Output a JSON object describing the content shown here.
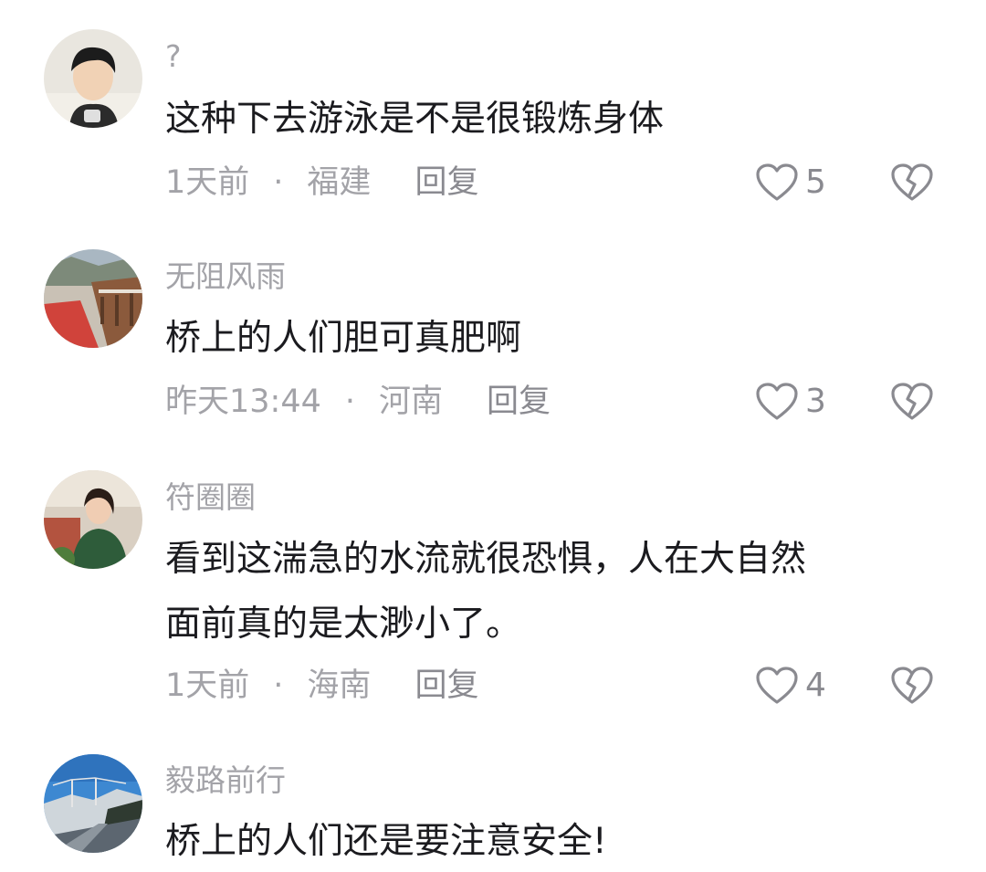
{
  "comments": [
    {
      "username": "?",
      "text_lines": [
        "这种下去游泳是不是很锻炼身体"
      ],
      "time": "1天前",
      "location": "福建",
      "reply_label": "回复",
      "likes": "5"
    },
    {
      "username": "无阻风雨",
      "text_lines": [
        "桥上的人们胆可真肥啊"
      ],
      "time": "昨天13:44",
      "location": "河南",
      "reply_label": "回复",
      "likes": "3"
    },
    {
      "username": "符圈圈",
      "text_lines": [
        "看到这湍急的水流就很恐惧，人在大自然",
        "面前真的是太渺小了。"
      ],
      "time": "1天前",
      "location": "海南",
      "reply_label": "回复",
      "likes": "4"
    },
    {
      "username": "毅路前行",
      "text_lines": [
        "桥上的人们还是要注意安全!"
      ]
    }
  ],
  "separator": "·",
  "icons": {
    "like": "heart-outline-icon",
    "dislike": "broken-heart-icon"
  },
  "colors": {
    "secondary_text": "#a3a3a8",
    "primary_text": "#1b1b1f",
    "icon_stroke": "#8a8a90"
  }
}
